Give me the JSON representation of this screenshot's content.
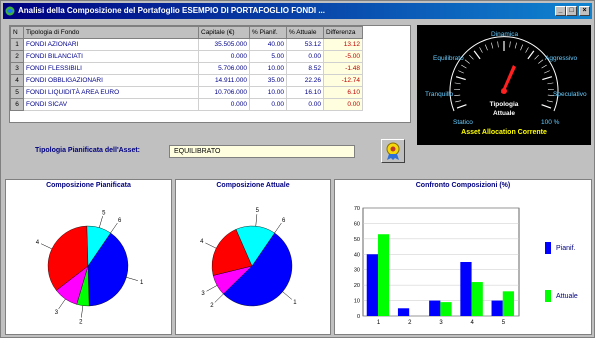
{
  "window": {
    "title": "Analisi della Composizione del Portafoglio ESEMPIO DI PORTAFOGLIO FONDI ...",
    "buttons": {
      "minimize": "_",
      "maximize": "□",
      "close": "×"
    }
  },
  "table": {
    "headers": [
      "N",
      "Tipologia di Fondo",
      "Capitale (€)",
      "% Pianif.",
      "% Attuale",
      "Differenza"
    ],
    "rows": [
      {
        "n": "1",
        "name": "FONDI AZIONARI",
        "capitale": "35.505.000",
        "pianif": "40.00",
        "attuale": "53.12",
        "diff": "13.12"
      },
      {
        "n": "2",
        "name": "FONDI BILANCIATI",
        "capitale": "0.000",
        "pianif": "5.00",
        "attuale": "0.00",
        "diff": "-5.00"
      },
      {
        "n": "3",
        "name": "FONDI FLESSIBILI",
        "capitale": "5.706.000",
        "pianif": "10.00",
        "attuale": "8.52",
        "diff": "-1.48"
      },
      {
        "n": "4",
        "name": "FONDI OBBLIGAZIONARI",
        "capitale": "14.911.000",
        "pianif": "35.00",
        "attuale": "22.26",
        "diff": "-12.74"
      },
      {
        "n": "5",
        "name": "FONDI LIQUIDITÀ AREA EURO",
        "capitale": "10.706.000",
        "pianif": "10.00",
        "attuale": "16.10",
        "diff": "6.10"
      },
      {
        "n": "6",
        "name": "FONDI SICAV",
        "capitale": "0.000",
        "pianif": "0.00",
        "attuale": "0.00",
        "diff": "0.00"
      }
    ]
  },
  "gauge": {
    "labels": [
      "Dinamica",
      "Equilibrato",
      "Aggressivo",
      "Tranquillo",
      "Speculativo",
      "Statico",
      "100 %"
    ],
    "center_line1": "Tipologia",
    "center_line2": "Attuale",
    "title": "Asset Allocation Corrente",
    "colors": {
      "background": "#000000",
      "labels": "#66ccff",
      "needle": "#ff2020",
      "title": "#ffff00"
    }
  },
  "planned": {
    "label": "Tipologia Pianificata dell'Asset:",
    "value": "EQUILIBRATO",
    "button_icon": "medal-icon"
  },
  "charts": {
    "pie_planned_title": "Composizione Pianificata",
    "pie_actual_title": "Composizione Attuale",
    "bar_title": "Confronto Composizioni (%)",
    "legend_planned": "Pianif.",
    "legend_actual": "Attuale"
  },
  "chart_data": [
    {
      "type": "pie",
      "title": "Composizione Pianificata",
      "labels": [
        "1",
        "2",
        "3",
        "4",
        "5",
        "6"
      ],
      "values": [
        40,
        5,
        10,
        35,
        10,
        0
      ],
      "colors": [
        "#0000ff",
        "#00ff00",
        "#ff00ff",
        "#ff0000",
        "#00ffff",
        "#ffff00"
      ]
    },
    {
      "type": "pie",
      "title": "Composizione Attuale",
      "labels": [
        "1",
        "2",
        "3",
        "4",
        "5",
        "6"
      ],
      "values": [
        53.12,
        0,
        8.52,
        22.26,
        16.1,
        0
      ],
      "colors": [
        "#0000ff",
        "#00ff00",
        "#ff00ff",
        "#ff0000",
        "#00ffff",
        "#ffff00"
      ]
    },
    {
      "type": "bar",
      "title": "Confronto Composizioni (%)",
      "categories": [
        "1",
        "2",
        "3",
        "4",
        "5"
      ],
      "series": [
        {
          "name": "Pianif.",
          "values": [
            40,
            5,
            10,
            35,
            10
          ],
          "color": "#0000ff"
        },
        {
          "name": "Attuale",
          "values": [
            53,
            0,
            9,
            22,
            16
          ],
          "color": "#00ff00"
        }
      ],
      "ylim": [
        0,
        70
      ],
      "yticks": [
        "0",
        "10",
        "20",
        "30",
        "40",
        "50",
        "60",
        "70"
      ]
    }
  ]
}
